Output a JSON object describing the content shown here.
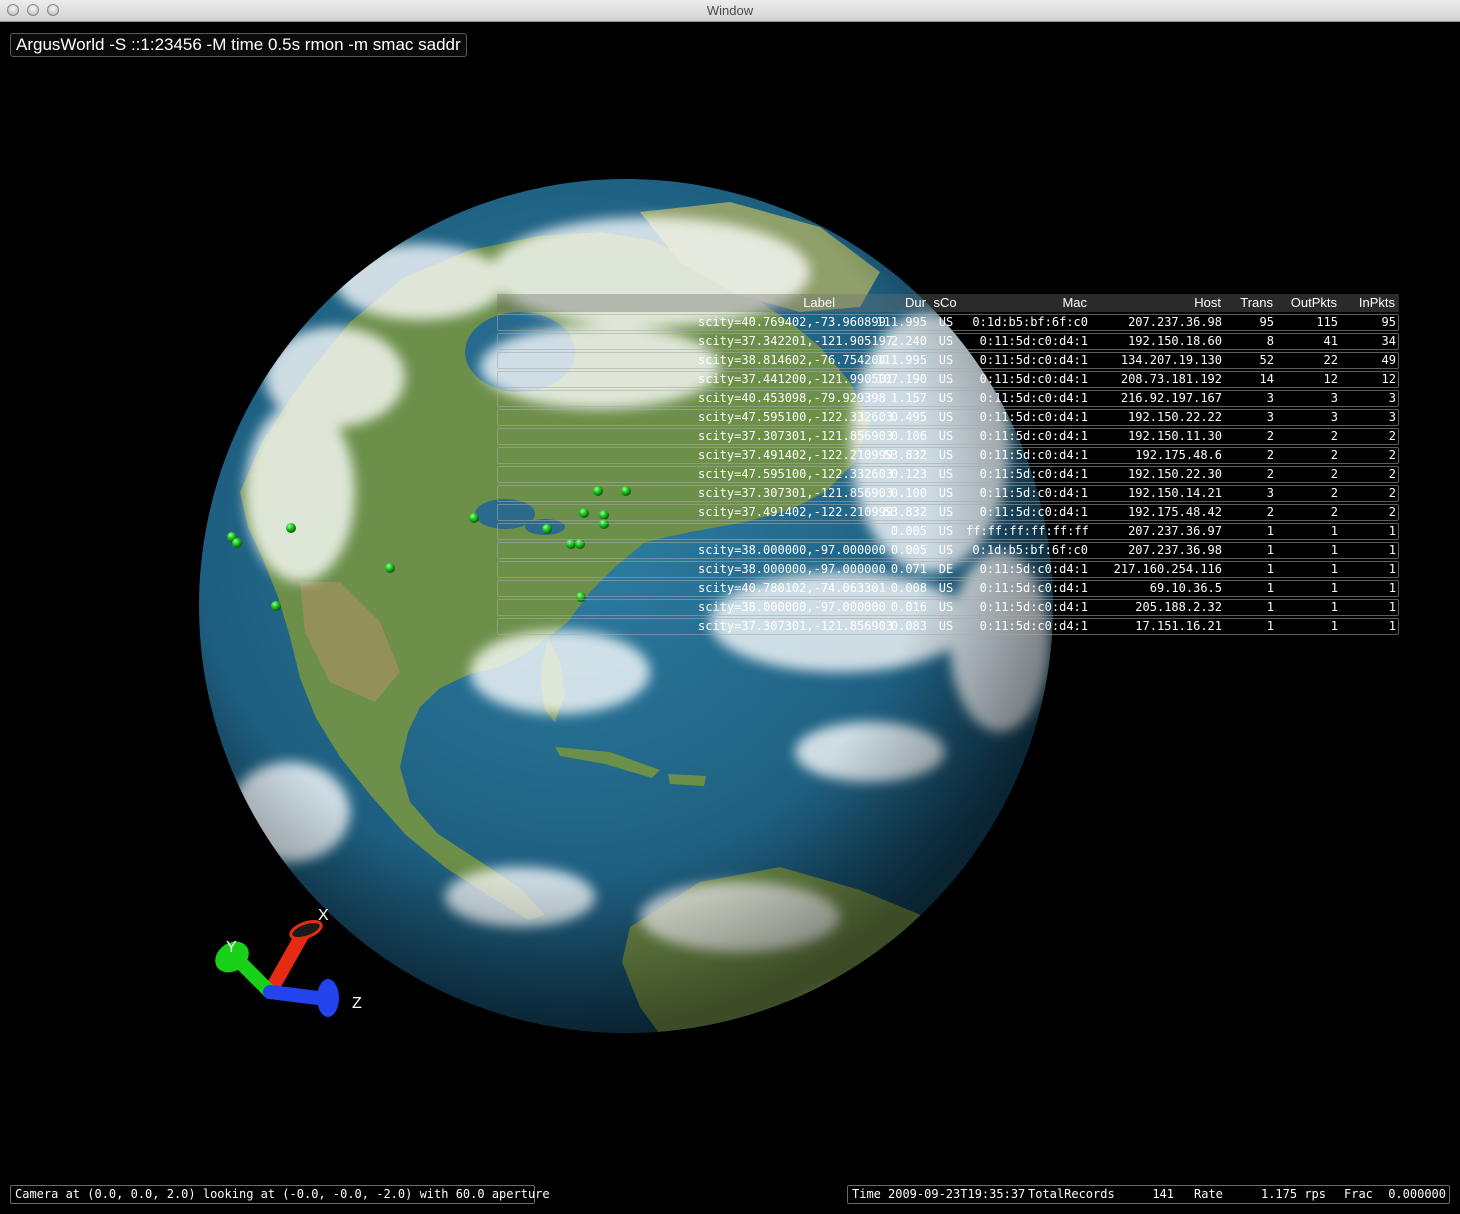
{
  "window": {
    "title": "Window"
  },
  "command_line": "ArgusWorld -S ::1:23456 -M time 0.5s rmon -m smac saddr",
  "axes": {
    "x": "X",
    "y": "Y",
    "z": "Z"
  },
  "table": {
    "headers": {
      "label": "Label",
      "dur": "Dur",
      "sco": "sCo",
      "mac": "Mac",
      "host": "Host",
      "trans": "Trans",
      "outpkts": "OutPkts",
      "inpkts": "InPkts"
    },
    "rows": [
      {
        "label": "scity=40.769402,-73.960899",
        "dur": "111.995",
        "sco": "US",
        "mac": "0:1d:b5:bf:6f:c0",
        "host": "207.237.36.98",
        "trans": "95",
        "outpkts": "115",
        "inpkts": "95"
      },
      {
        "label": "scity=37.342201,-121.905197",
        "dur": "2.240",
        "sco": "US",
        "mac": "0:11:5d:c0:d4:1",
        "host": "192.150.18.60",
        "trans": "8",
        "outpkts": "41",
        "inpkts": "34"
      },
      {
        "label": "scity=38.814602,-76.754204",
        "dur": "111.995",
        "sco": "US",
        "mac": "0:11:5d:c0:d4:1",
        "host": "134.207.19.130",
        "trans": "52",
        "outpkts": "22",
        "inpkts": "49"
      },
      {
        "label": "scity=37.441200,-121.990501",
        "dur": "107.190",
        "sco": "US",
        "mac": "0:11:5d:c0:d4:1",
        "host": "208.73.181.192",
        "trans": "14",
        "outpkts": "12",
        "inpkts": "12"
      },
      {
        "label": "scity=40.453098,-79.929398",
        "dur": "1.157",
        "sco": "US",
        "mac": "0:11:5d:c0:d4:1",
        "host": "216.92.197.167",
        "trans": "3",
        "outpkts": "3",
        "inpkts": "3"
      },
      {
        "label": "scity=47.595100,-122.332603",
        "dur": "0.495",
        "sco": "US",
        "mac": "0:11:5d:c0:d4:1",
        "host": "192.150.22.22",
        "trans": "3",
        "outpkts": "3",
        "inpkts": "3"
      },
      {
        "label": "scity=37.307301,-121.856903",
        "dur": "0.106",
        "sco": "US",
        "mac": "0:11:5d:c0:d4:1",
        "host": "192.150.11.30",
        "trans": "2",
        "outpkts": "2",
        "inpkts": "2"
      },
      {
        "label": "scity=37.491402,-122.210999",
        "dur": "53.832",
        "sco": "US",
        "mac": "0:11:5d:c0:d4:1",
        "host": "192.175.48.6",
        "trans": "2",
        "outpkts": "2",
        "inpkts": "2"
      },
      {
        "label": "scity=47.595100,-122.332603",
        "dur": "0.123",
        "sco": "US",
        "mac": "0:11:5d:c0:d4:1",
        "host": "192.150.22.30",
        "trans": "2",
        "outpkts": "2",
        "inpkts": "2"
      },
      {
        "label": "scity=37.307301,-121.856903",
        "dur": "0.100",
        "sco": "US",
        "mac": "0:11:5d:c0:d4:1",
        "host": "192.150.14.21",
        "trans": "3",
        "outpkts": "2",
        "inpkts": "2"
      },
      {
        "label": "scity=37.491402,-122.210999",
        "dur": "53.832",
        "sco": "US",
        "mac": "0:11:5d:c0:d4:1",
        "host": "192.175.48.42",
        "trans": "2",
        "outpkts": "2",
        "inpkts": "2"
      },
      {
        "label": "",
        "dur": "0.005",
        "sco": "US",
        "mac": "ff:ff:ff:ff:ff:ff",
        "host": "207.237.36.97",
        "trans": "1",
        "outpkts": "1",
        "inpkts": "1"
      },
      {
        "label": "scity=38.000000,-97.000000",
        "dur": "0.005",
        "sco": "US",
        "mac": "0:1d:b5:bf:6f:c0",
        "host": "207.237.36.98",
        "trans": "1",
        "outpkts": "1",
        "inpkts": "1"
      },
      {
        "label": "scity=38.000000,-97.000000",
        "dur": "0.071",
        "sco": "DE",
        "mac": "0:11:5d:c0:d4:1",
        "host": "217.160.254.116",
        "trans": "1",
        "outpkts": "1",
        "inpkts": "1"
      },
      {
        "label": "scity=40.780102,-74.063301",
        "dur": "0.008",
        "sco": "US",
        "mac": "0:11:5d:c0:d4:1",
        "host": "69.10.36.5",
        "trans": "1",
        "outpkts": "1",
        "inpkts": "1"
      },
      {
        "label": "scity=38.000000,-97.000000",
        "dur": "0.016",
        "sco": "US",
        "mac": "0:11:5d:c0:d4:1",
        "host": "205.188.2.32",
        "trans": "1",
        "outpkts": "1",
        "inpkts": "1"
      },
      {
        "label": "scity=37.307301,-121.856903",
        "dur": "0.083",
        "sco": "US",
        "mac": "0:11:5d:c0:d4:1",
        "host": "17.151.16.21",
        "trans": "1",
        "outpkts": "1",
        "inpkts": "1"
      }
    ]
  },
  "status_left": "Camera at (0.0, 0.0, 2.0) looking at (-0.0, -0.0, -2.0) with 60.0 aperture",
  "status_right": {
    "time_label": "Time",
    "time_value": "2009-09-23T19:35:37",
    "records_label": "TotalRecords",
    "records_value": "141",
    "rate_label": "Rate",
    "rate_value": "1.175 rps",
    "frac_label": "Frac",
    "frac_value": "0.000000"
  },
  "colors": {
    "ocean": "#1d5d7e",
    "land": "#6c8f4a",
    "marker": "#22cc22",
    "axis_x": "#e52b12",
    "axis_y": "#19d019",
    "axis_z": "#2244ee"
  }
}
